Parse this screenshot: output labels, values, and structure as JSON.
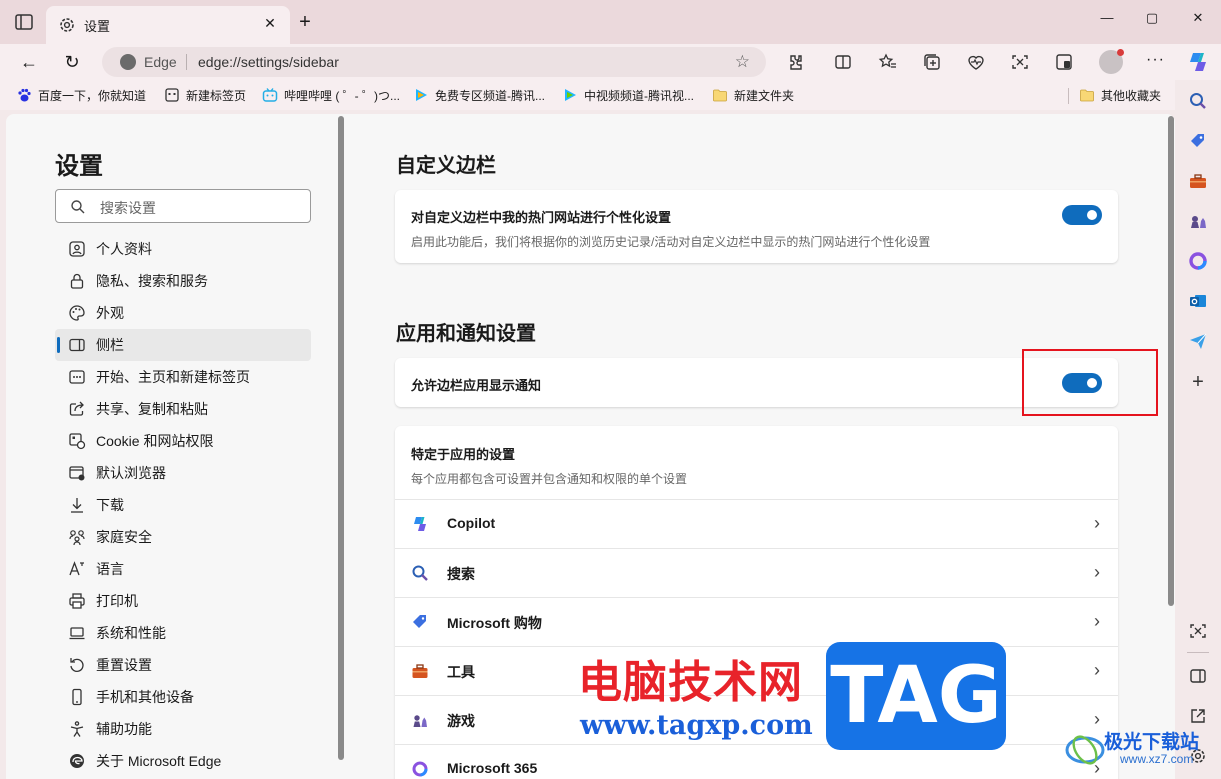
{
  "browser": {
    "tab_title": "设置",
    "omnibox_brand": "Edge",
    "url": "edge://settings/sidebar"
  },
  "bookmarks": [
    "百度一下，你就知道",
    "新建标签页",
    "哔哩哔哩 ( ゜- ゜)つ...",
    "免费专区频道-腾讯...",
    "中视频频道-腾讯视...",
    "新建文件夹"
  ],
  "other_bookmarks": "其他收藏夹",
  "settings_nav": {
    "title": "设置",
    "search_placeholder": "搜索设置",
    "items": [
      {
        "label": "个人资料",
        "icon": "profile-icon"
      },
      {
        "label": "隐私、搜索和服务",
        "icon": "lock-icon"
      },
      {
        "label": "外观",
        "icon": "palette-icon"
      },
      {
        "label": "侧栏",
        "icon": "sidebar-icon",
        "active": true
      },
      {
        "label": "开始、主页和新建标签页",
        "icon": "home-grid-icon"
      },
      {
        "label": "共享、复制和粘贴",
        "icon": "share-icon"
      },
      {
        "label": "Cookie 和网站权限",
        "icon": "cookie-icon"
      },
      {
        "label": "默认浏览器",
        "icon": "browser-icon"
      },
      {
        "label": "下载",
        "icon": "download-icon"
      },
      {
        "label": "家庭安全",
        "icon": "family-icon"
      },
      {
        "label": "语言",
        "icon": "language-icon"
      },
      {
        "label": "打印机",
        "icon": "printer-icon"
      },
      {
        "label": "系统和性能",
        "icon": "laptop-icon"
      },
      {
        "label": "重置设置",
        "icon": "reset-icon"
      },
      {
        "label": "手机和其他设备",
        "icon": "phone-icon"
      },
      {
        "label": "辅助功能",
        "icon": "accessibility-icon"
      },
      {
        "label": "关于 Microsoft Edge",
        "icon": "edge-logo-icon"
      }
    ]
  },
  "main": {
    "section1_title": "自定义边栏",
    "card1": {
      "title": "对自定义边栏中我的热门网站进行个性化设置",
      "desc": "启用此功能后，我们将根据你的浏览历史记录/活动对自定义边栏中显示的热门网站进行个性化设置",
      "toggle_on": true
    },
    "section2_title": "应用和通知设置",
    "card2": {
      "title": "允许边栏应用显示通知",
      "toggle_on": true
    },
    "card3": {
      "title": "特定于应用的设置",
      "desc": "每个应用都包含可设置并包含通知和权限的单个设置",
      "apps": [
        {
          "label": "Copilot",
          "icon": "copilot-icon"
        },
        {
          "label": "搜索",
          "icon": "search-icon"
        },
        {
          "label": "Microsoft 购物",
          "icon": "shopping-tag-icon"
        },
        {
          "label": "工具",
          "icon": "toolbox-icon"
        },
        {
          "label": "游戏",
          "icon": "chess-icon"
        },
        {
          "label": "Microsoft 365",
          "icon": "m365-icon"
        }
      ]
    }
  },
  "watermark": {
    "cn_text": "电脑技术网",
    "url": "www.tagxp.com",
    "tag": "TAG",
    "site2_name": "极光下载站",
    "site2_url": "www.xz7.com"
  },
  "colors": {
    "accent": "#0f6cbd",
    "frame": "#ebd9dc",
    "highlight_box": "#e5141e"
  }
}
